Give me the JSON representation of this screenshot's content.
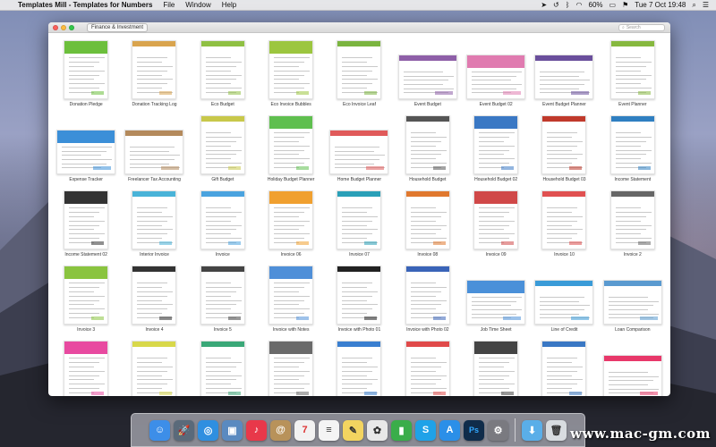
{
  "menubar": {
    "app_name": "Templates Mill - Templates for Numbers",
    "menus": [
      "File",
      "Window",
      "Help"
    ],
    "battery": "60%",
    "datetime": "Tue 7 Oct  19:48"
  },
  "window": {
    "category": "Finance & Investment",
    "search_placeholder": "Search"
  },
  "templates": [
    {
      "label": "Donation Pledge",
      "orient": "portrait",
      "accent": "#6cbf3c"
    },
    {
      "label": "Donation Tracking Log",
      "orient": "portrait",
      "accent": "#d9a44e"
    },
    {
      "label": "Eco Budget",
      "orient": "portrait",
      "accent": "#8fc043"
    },
    {
      "label": "Eco Invoice Bubbles",
      "orient": "portrait",
      "accent": "#9cc63f"
    },
    {
      "label": "Eco Invoice Leaf",
      "orient": "portrait",
      "accent": "#7bb540"
    },
    {
      "label": "Event Budget",
      "orient": "landscape",
      "accent": "#8e5fa8"
    },
    {
      "label": "Event Budget 02",
      "orient": "landscape",
      "accent": "#e07bb0"
    },
    {
      "label": "Event Budget Planner",
      "orient": "landscape",
      "accent": "#6a4f9c"
    },
    {
      "label": "Event Planner",
      "orient": "portrait",
      "accent": "#86b83f"
    },
    {
      "label": "Expense Tracker",
      "orient": "landscape",
      "accent": "#3b8fd8"
    },
    {
      "label": "Freelancer Tax Accounting",
      "orient": "landscape",
      "accent": "#b48a5c"
    },
    {
      "label": "Gift Budget",
      "orient": "portrait",
      "accent": "#c8c84a"
    },
    {
      "label": "Holiday Budget Planner",
      "orient": "portrait",
      "accent": "#5fbf4f"
    },
    {
      "label": "Home Budget Planner",
      "orient": "landscape",
      "accent": "#e05a5a"
    },
    {
      "label": "Household Budget",
      "orient": "portrait",
      "accent": "#555555"
    },
    {
      "label": "Household Budget 02",
      "orient": "portrait",
      "accent": "#3a78c4"
    },
    {
      "label": "Household Budget 03",
      "orient": "portrait",
      "accent": "#c0392b"
    },
    {
      "label": "Income Statement",
      "orient": "portrait",
      "accent": "#2f7fc1"
    },
    {
      "label": "Income Statement 02",
      "orient": "portrait",
      "accent": "#333333"
    },
    {
      "label": "Interior Invoice",
      "orient": "portrait",
      "accent": "#49b3d8"
    },
    {
      "label": "Invoice",
      "orient": "portrait",
      "accent": "#4aa3df"
    },
    {
      "label": "Invoice 06",
      "orient": "portrait",
      "accent": "#f0a030"
    },
    {
      "label": "Invoice 07",
      "orient": "portrait",
      "accent": "#2aa0b8"
    },
    {
      "label": "Invoice 08",
      "orient": "portrait",
      "accent": "#e0782e"
    },
    {
      "label": "Invoice 09",
      "orient": "portrait",
      "accent": "#d04848"
    },
    {
      "label": "Invoice 10",
      "orient": "portrait",
      "accent": "#e05050"
    },
    {
      "label": "Invoice 2",
      "orient": "portrait",
      "accent": "#666666"
    },
    {
      "label": "Invoice 3",
      "orient": "portrait",
      "accent": "#8ac43f"
    },
    {
      "label": "Invoice 4",
      "orient": "portrait",
      "accent": "#333333"
    },
    {
      "label": "Invoice 5",
      "orient": "portrait",
      "accent": "#444444"
    },
    {
      "label": "Invoice with Notes",
      "orient": "portrait",
      "accent": "#4f8fd8"
    },
    {
      "label": "Invoice with Photo 01",
      "orient": "portrait",
      "accent": "#222222"
    },
    {
      "label": "Invoice with Photo 02",
      "orient": "portrait",
      "accent": "#3a64b8"
    },
    {
      "label": "Job Time Sheet",
      "orient": "landscape",
      "accent": "#4a90d9"
    },
    {
      "label": "Line of Credit",
      "orient": "landscape",
      "accent": "#3a9bd8"
    },
    {
      "label": "Loan Comparison",
      "orient": "landscape",
      "accent": "#5a9ad0"
    },
    {
      "label": "",
      "orient": "portrait",
      "accent": "#e84aa0"
    },
    {
      "label": "",
      "orient": "portrait",
      "accent": "#d8d84a"
    },
    {
      "label": "",
      "orient": "portrait",
      "accent": "#3aa878"
    },
    {
      "label": "",
      "orient": "portrait",
      "accent": "#6a6a6a"
    },
    {
      "label": "",
      "orient": "portrait",
      "accent": "#3a7fd0"
    },
    {
      "label": "",
      "orient": "portrait",
      "accent": "#e04a4a"
    },
    {
      "label": "",
      "orient": "portrait",
      "accent": "#444444"
    },
    {
      "label": "",
      "orient": "portrait",
      "accent": "#3a78c4"
    },
    {
      "label": "",
      "orient": "landscape",
      "accent": "#e8386a"
    }
  ],
  "dock": [
    {
      "name": "finder-icon",
      "color": "#3d8ee8",
      "glyph": "☺"
    },
    {
      "name": "launchpad-icon",
      "color": "#5a6a7a",
      "glyph": "🚀"
    },
    {
      "name": "safari-icon",
      "color": "#2f8fe0",
      "glyph": "◎"
    },
    {
      "name": "preview-icon",
      "color": "#5a8ac0",
      "glyph": "▣"
    },
    {
      "name": "itunes-icon",
      "color": "#e8384a",
      "glyph": "♪"
    },
    {
      "name": "contacts-icon",
      "color": "#b8925a",
      "glyph": "@"
    },
    {
      "name": "calendar-icon",
      "color": "#f2f2f2",
      "glyph": "7"
    },
    {
      "name": "reminders-icon",
      "color": "#f4f4f4",
      "glyph": "≡"
    },
    {
      "name": "notes-icon",
      "color": "#f3d460",
      "glyph": "✎"
    },
    {
      "name": "photos-icon",
      "color": "#e8e8e8",
      "glyph": "✿"
    },
    {
      "name": "numbers-icon",
      "color": "#3aad4a",
      "glyph": "▮"
    },
    {
      "name": "skype-icon",
      "color": "#1fa2e8",
      "glyph": "S"
    },
    {
      "name": "app-store-icon",
      "color": "#2b8fe8",
      "glyph": "A"
    },
    {
      "name": "photoshop-icon",
      "color": "#102c4a",
      "glyph": "Ps"
    },
    {
      "name": "system-preferences-icon",
      "color": "#7a7a80",
      "glyph": "⚙"
    },
    {
      "name": "downloads-folder-icon",
      "color": "#5aaee8",
      "glyph": "⬇"
    },
    {
      "name": "trash-icon",
      "color": "#d8dce0",
      "glyph": "🗑"
    }
  ],
  "watermark": "www.mac-gm.com"
}
